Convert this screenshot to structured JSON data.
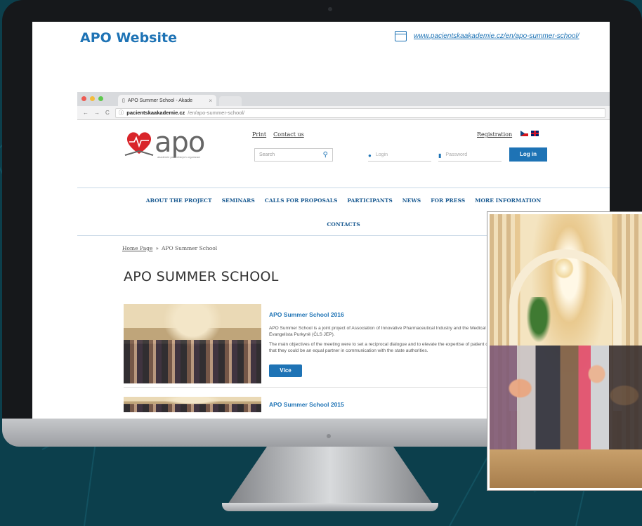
{
  "page": {
    "site_title": "APO Website",
    "url_link": "www.pacientskaakademie.cz/en/apo-summer-school/"
  },
  "browser": {
    "tab_title": "APO Summer School - Akade",
    "tab_close": "×",
    "address_domain": "pacientskaakademie.cz",
    "address_path": "/en/apo-summer-school/",
    "reload_glyph": "C",
    "back_glyph": "←",
    "forward_glyph": "→",
    "secure_glyph": "ⓘ"
  },
  "site": {
    "logo_text": "apo",
    "logo_sub": "akademie pacientských organizací",
    "top_links": [
      "Print",
      "Contact us"
    ],
    "registration": "Registration",
    "search_placeholder": "Search",
    "login_placeholder": "Login",
    "password_placeholder": "Password",
    "login_button": "Log in",
    "nav": [
      "ABOUT THE PROJECT",
      "SEMINARS",
      "CALLS FOR PROPOSALS",
      "PARTICIPANTS",
      "NEWS",
      "FOR PRESS",
      "MORE INFORMATION"
    ],
    "nav2": [
      "CONTACTS"
    ],
    "breadcrumb": {
      "home": "Home Page",
      "separator": "»",
      "current": "APO Summer School"
    },
    "heading": "APO SUMMER SCHOOL",
    "articles": [
      {
        "title": "APO Summer School 2016",
        "text1": "APO Summer School is a joint project of Association of Innovative Pharmaceutical Industry and the Medical Society of Jan Evangelista Purkyně (ČLS JEP).",
        "text2": "The main objectives of the meeting were to set a reciprocal dialogue and to elevate the expertise of patient organizations so that they could be an equal partner in communication with the state authorities.",
        "button": "Více"
      },
      {
        "title": "APO Summer School 2015"
      }
    ]
  },
  "colors": {
    "accent": "#1e73b5",
    "background": "#0c3f4c"
  },
  "icons": {
    "browser_window": "browser-window-icon",
    "search": "search-icon",
    "user": "user-icon",
    "lock": "lock-icon",
    "heart": "heart-logo-icon"
  }
}
